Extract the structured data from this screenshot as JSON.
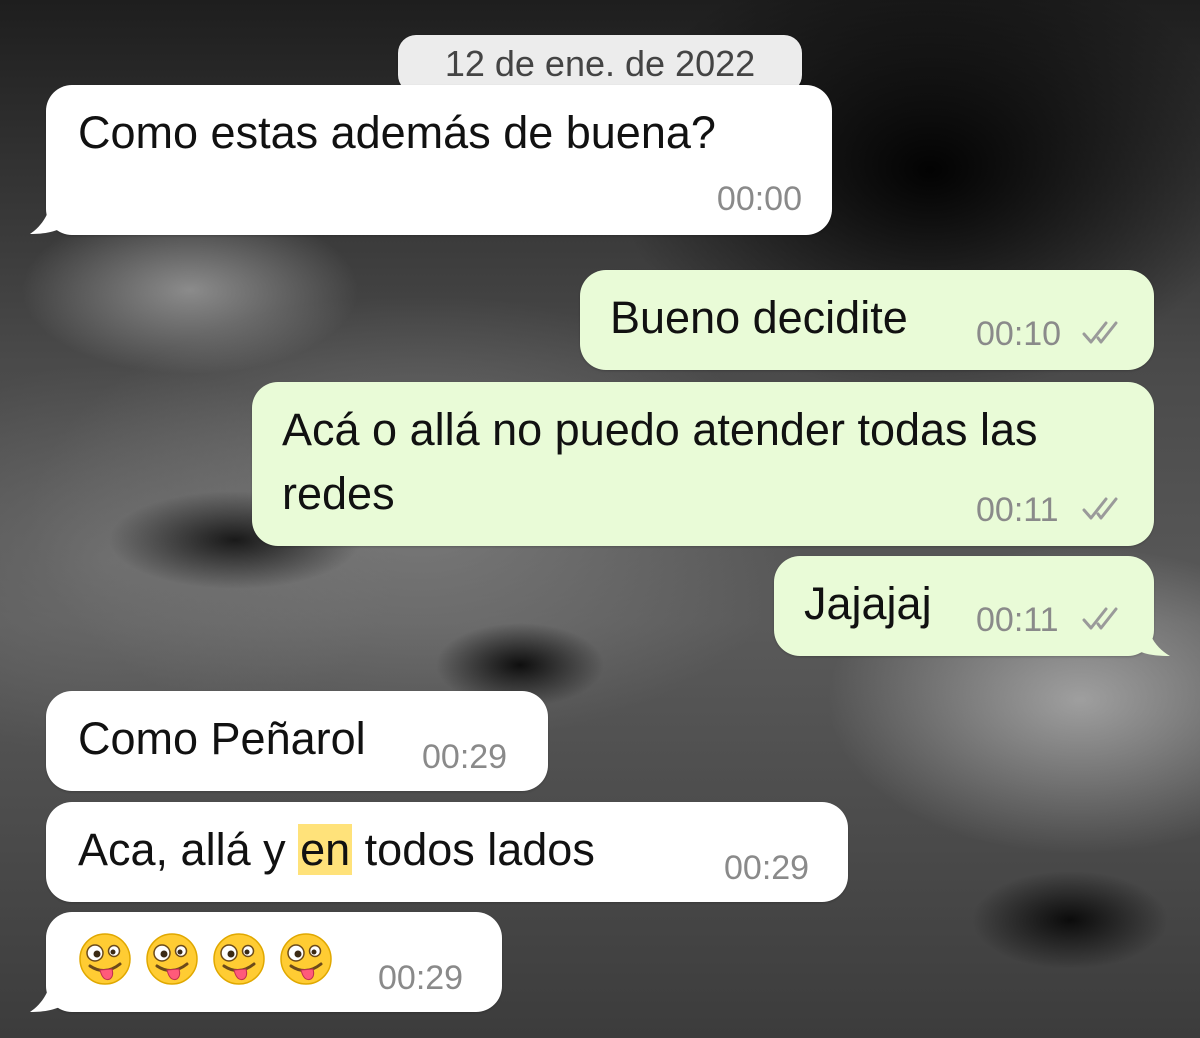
{
  "date_chip": "12 de ene. de 2022",
  "messages": [
    {
      "direction": "incoming",
      "text": "Como estas además de buena?",
      "time": "00:00"
    },
    {
      "direction": "outgoing",
      "text": "Bueno decidite",
      "time": "00:10",
      "status": "read"
    },
    {
      "direction": "outgoing",
      "text_line1": "Acá o allá no puedo atender todas las",
      "text_line2": "redes",
      "time": "00:11",
      "status": "read"
    },
    {
      "direction": "outgoing",
      "text": "Jajajaj",
      "time": "00:11",
      "status": "read"
    },
    {
      "direction": "incoming",
      "text": "Como Peñarol",
      "time": "00:29"
    },
    {
      "direction": "incoming",
      "text_before": "Aca, allá y ",
      "text_highlight": "en",
      "text_after": " todos lados",
      "time": "00:29"
    },
    {
      "direction": "incoming",
      "emoji": "zany-face-emoji",
      "emoji_count": 4,
      "time": "00:29"
    }
  ],
  "colors": {
    "incoming_bubble": "#ffffff",
    "outgoing_bubble": "#e9fbd7",
    "highlight": "#ffe27a",
    "date_chip": "#ececec",
    "timestamp": "#8a8a8a"
  }
}
